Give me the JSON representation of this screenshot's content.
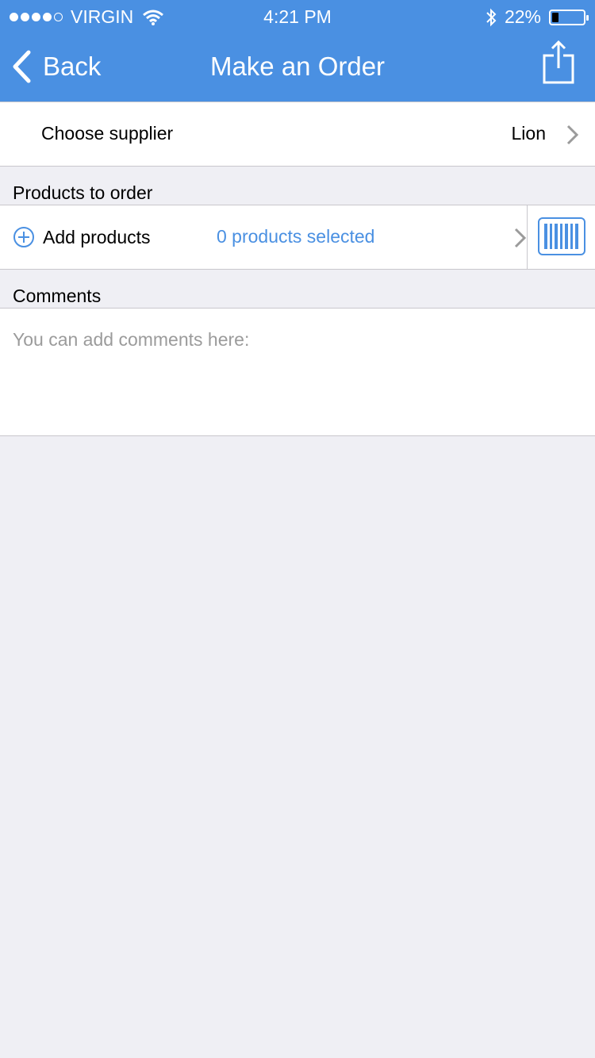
{
  "status_bar": {
    "carrier": "VIRGIN",
    "time": "4:21 PM",
    "battery": "22%",
    "battery_level": 0.22,
    "signal_bars_filled": 4,
    "signal_bars_total": 5
  },
  "nav": {
    "back_label": "Back",
    "title": "Make an Order"
  },
  "supplier": {
    "label": "Choose supplier",
    "value": "Lion"
  },
  "products": {
    "section_title": "Products to order",
    "add_label": "Add products",
    "selected_text": "0 products selected"
  },
  "comments": {
    "section_title": "Comments",
    "placeholder": "You can add comments here:",
    "value": ""
  },
  "colors": {
    "accent": "#4a90e2",
    "background": "#efeff4",
    "separator": "#c8c7cc",
    "placeholder": "#9b9b9b"
  },
  "icons": [
    "back-chevron-icon",
    "share-icon",
    "chevron-right-icon",
    "plus-circle-icon",
    "barcode-icon",
    "wifi-icon",
    "bluetooth-icon",
    "battery-icon"
  ]
}
